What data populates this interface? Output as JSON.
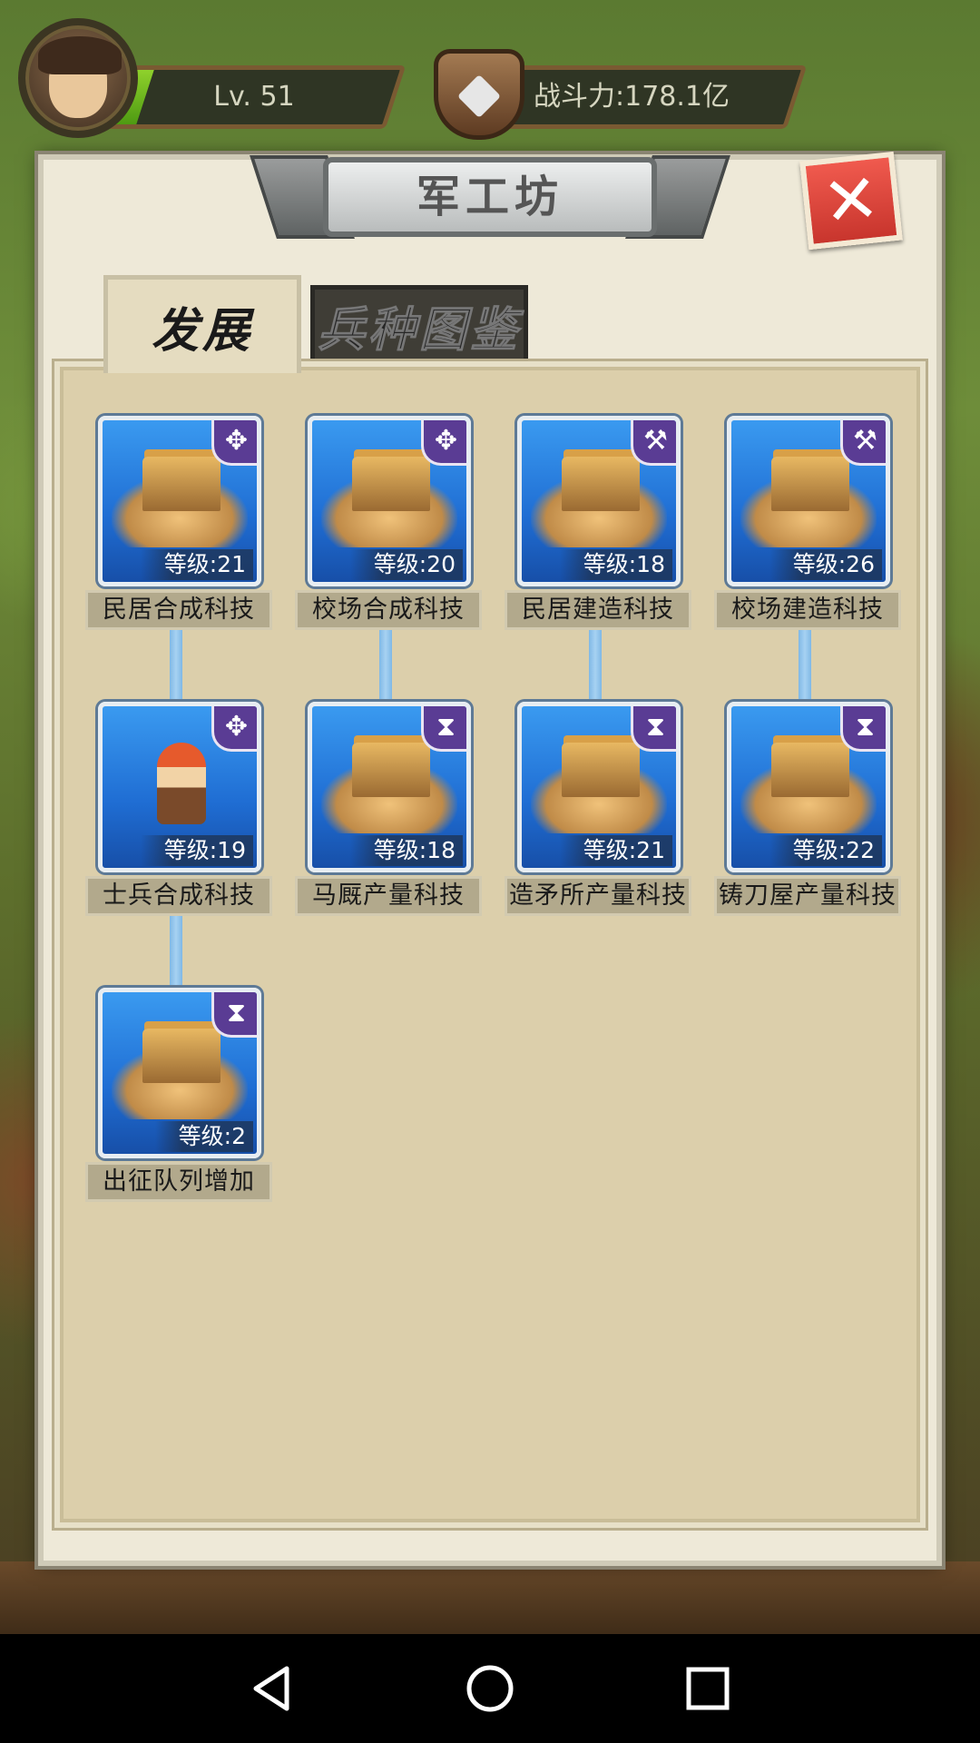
{
  "hud": {
    "level_text": "Lv. 51",
    "level_progress": 0.12,
    "power_text": "战斗力:178.1亿"
  },
  "dialog": {
    "title": "军工坊",
    "close_icon": "close-x-icon",
    "tabs": [
      {
        "label": "发展",
        "active": true
      },
      {
        "label": "兵种图鉴",
        "active": false
      }
    ]
  },
  "tech": [
    {
      "name": "民居合成科技",
      "level": "等级:21",
      "icon": "merge-icon",
      "badge": "✥"
    },
    {
      "name": "校场合成科技",
      "level": "等级:20",
      "icon": "merge-icon",
      "badge": "✥"
    },
    {
      "name": "民居建造科技",
      "level": "等级:18",
      "icon": "hammer-icon",
      "badge": "⚒"
    },
    {
      "name": "校场建造科技",
      "level": "等级:26",
      "icon": "hammer-icon",
      "badge": "⚒"
    },
    {
      "name": "士兵合成科技",
      "level": "等级:19",
      "icon": "merge-icon",
      "badge": "✥"
    },
    {
      "name": "马厩产量科技",
      "level": "等级:18",
      "icon": "hourglass-icon",
      "badge": "⧗"
    },
    {
      "name": "造矛所产量科技",
      "level": "等级:21",
      "icon": "hourglass-icon",
      "badge": "⧗"
    },
    {
      "name": "铸刀屋产量科技",
      "level": "等级:22",
      "icon": "hourglass-icon",
      "badge": "⧗"
    },
    {
      "name": "出征队列增加",
      "level": "等级:2",
      "icon": "hourglass-icon",
      "badge": "⧗"
    }
  ],
  "navbar": {
    "back_icon": "back-triangle-icon",
    "home_icon": "home-circle-icon",
    "recent_icon": "recent-square-icon"
  }
}
